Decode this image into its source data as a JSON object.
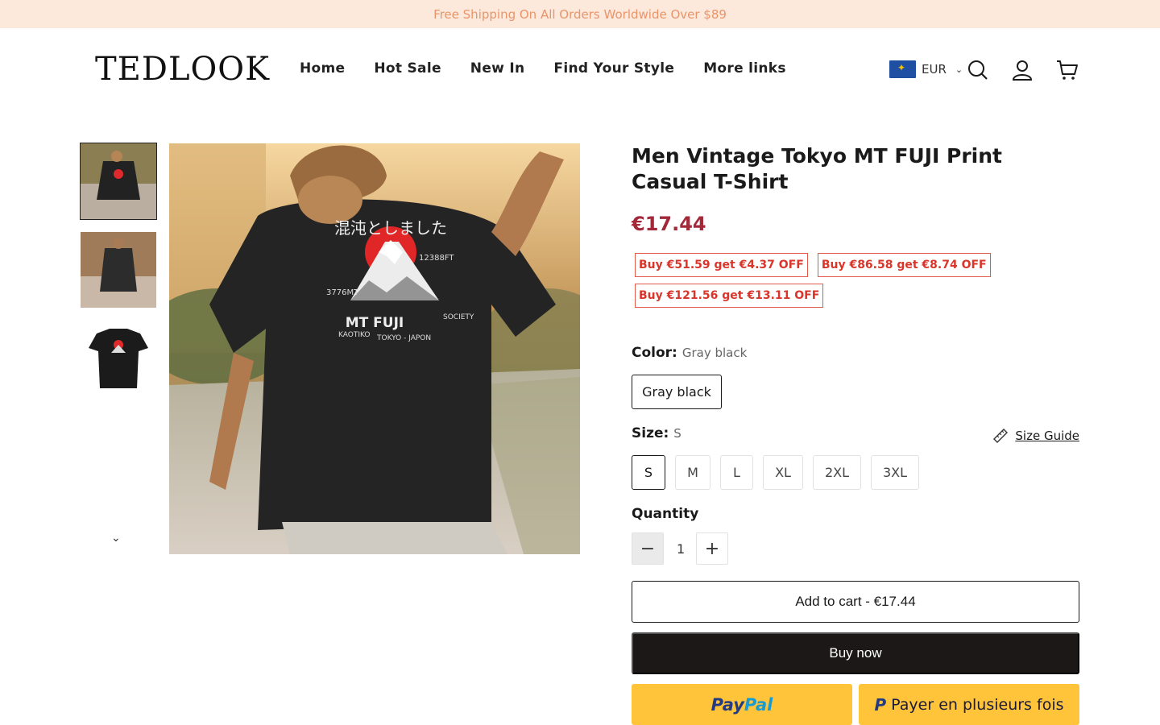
{
  "announcement": "Free Shipping On All Orders Worldwide Over $89",
  "header": {
    "logo": "TEDLOOK",
    "nav": [
      "Home",
      "Hot Sale",
      "New In",
      "Find Your Style",
      "More links"
    ],
    "currency": "EUR"
  },
  "product": {
    "title": "Men Vintage Tokyo MT FUJI Print Casual T-Shirt",
    "price": "€17.44",
    "discounts": [
      "Buy €51.59 get €4.37 OFF",
      "Buy €86.58 get €8.74 OFF",
      "Buy €121.56 get €13.11 OFF"
    ],
    "color_label": "Color:",
    "color_value": "Gray black",
    "color_options": [
      "Gray black"
    ],
    "size_label": "Size:",
    "size_value": "S",
    "size_guide": "Size Guide",
    "sizes": [
      "S",
      "M",
      "L",
      "XL",
      "2XL",
      "3XL"
    ],
    "quantity_label": "Quantity",
    "quantity": "1",
    "add_to_cart": "Add to cart - €17.44",
    "buy_now": "Buy now",
    "paypal_a": "Pay",
    "paypal_b": "Pal",
    "pay_later": "Payer en plusieurs fois"
  },
  "print": {
    "kana": "混沌としました",
    "height_m": "3776MT",
    "height_ft": "12388FT",
    "mt_fuji": "MT FUJI",
    "society": "SOCIETY",
    "kaotiko": "KAOTIKO",
    "tokyo_japon": "TOKYO - JAPON"
  },
  "colors": {
    "accent": "#a3283a",
    "discount": "#d9352a",
    "announce_bg": "#fde8dc",
    "paypal": "#ffc439"
  }
}
